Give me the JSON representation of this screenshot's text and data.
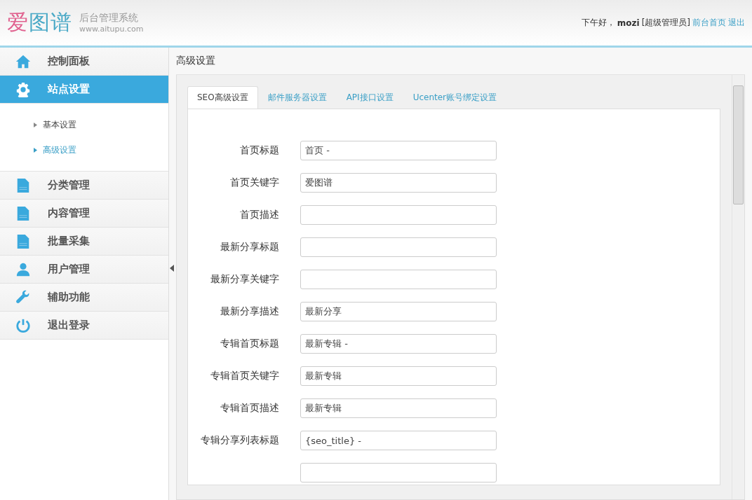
{
  "header": {
    "logo": "爱图谱",
    "subtitle": "后台管理系统",
    "url": "www.aitupu.com",
    "greeting": "下午好，",
    "user": "mozi",
    "role": "[超级管理员]",
    "links": [
      "前台首页",
      "退出"
    ]
  },
  "sidebar": {
    "items": [
      {
        "label": "控制面板",
        "kind": "home",
        "selected": false
      },
      {
        "label": "站点设置",
        "kind": "gear",
        "selected": true,
        "children": [
          {
            "label": "基本设置",
            "selected": false
          },
          {
            "label": "高级设置",
            "selected": true
          }
        ]
      },
      {
        "label": "分类管理",
        "kind": "doc",
        "selected": false
      },
      {
        "label": "内容管理",
        "kind": "doc",
        "selected": false
      },
      {
        "label": "批量采集",
        "kind": "doc",
        "selected": false
      },
      {
        "label": "用户管理",
        "kind": "user",
        "selected": false
      },
      {
        "label": "辅助功能",
        "kind": "wrench",
        "selected": false
      },
      {
        "label": "退出登录",
        "kind": "power",
        "selected": false
      }
    ]
  },
  "page_title": "高级设置",
  "tabs": [
    {
      "label": "SEO高级设置",
      "selected": true
    },
    {
      "label": "邮件服务器设置",
      "selected": false
    },
    {
      "label": "API接口设置",
      "selected": false
    },
    {
      "label": "Ucenter账号绑定设置",
      "selected": false
    }
  ],
  "form": [
    {
      "kind": "row",
      "label": "首页标题",
      "value": "首页 -"
    },
    {
      "kind": "row",
      "label": "首页关键字",
      "value": "爱图谱"
    },
    {
      "kind": "row",
      "label": "首页描述"
    },
    {
      "kind": "row",
      "label": "最新分享标题"
    },
    {
      "kind": "row",
      "label": "最新分享关键字"
    },
    {
      "kind": "row",
      "label": "最新分享描述",
      "value": "最新分享"
    },
    {
      "kind": "row",
      "label": "专辑首页标题",
      "value": "最新专辑 -"
    },
    {
      "kind": "row",
      "label": "专辑首页关键字",
      "value": "最新专辑"
    },
    {
      "kind": "row",
      "label": "专辑首页描述",
      "value": "最新专辑"
    },
    {
      "kind": "row",
      "label": "专辑分享列表标题",
      "value": "{seo_title} -"
    },
    {
      "kind": "cut"
    }
  ]
}
